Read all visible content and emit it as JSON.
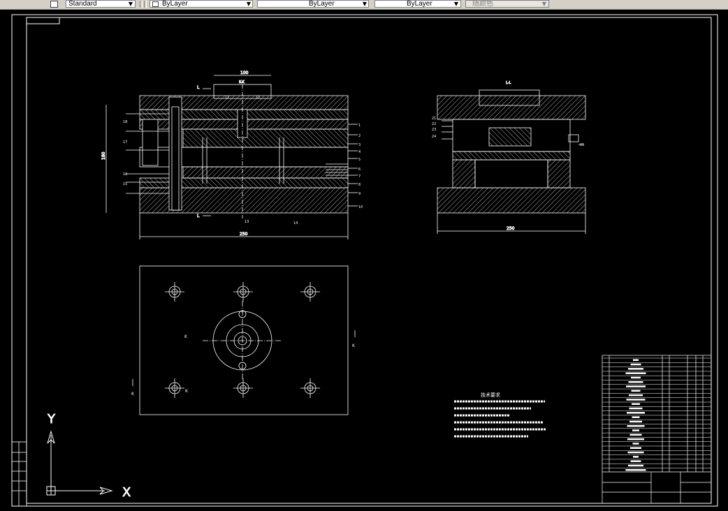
{
  "toolbar": {
    "text_style_value": "Standard",
    "color_value": "ByLayer",
    "linetype_value": "ByLayer",
    "lineweight_value": "ByLayer",
    "plotstyle_value": "随颜色"
  },
  "colors": {
    "background": "#000000",
    "line": "#ffffff",
    "accent_blue": "#4f5fff",
    "toolbar": "#d4d0c8"
  },
  "drawing": {
    "section_views": {
      "front_dimension_top": "100",
      "front_dimension_bottom": "250",
      "side_dimension_bottom": "250",
      "height_dimension": "180",
      "section_label_front": "K-K",
      "section_label_side": "L-L",
      "front_cut_marks": [
        "L",
        "L"
      ],
      "plan_cut_marks": [
        "K",
        "K",
        "K",
        "K"
      ],
      "part_labels_left": [
        "18",
        "17",
        "16",
        "15"
      ],
      "part_labels_right": [
        "1",
        "2",
        "3",
        "4",
        "5",
        "6",
        "7",
        "8",
        "9",
        "10",
        "11",
        "12",
        "13",
        "14"
      ],
      "side_labels": [
        "21",
        "22",
        "23",
        "24",
        "25"
      ]
    },
    "technical_notes": {
      "title": "技术要求"
    }
  },
  "ucs": {
    "y_label": "Y",
    "x_label": "X"
  }
}
